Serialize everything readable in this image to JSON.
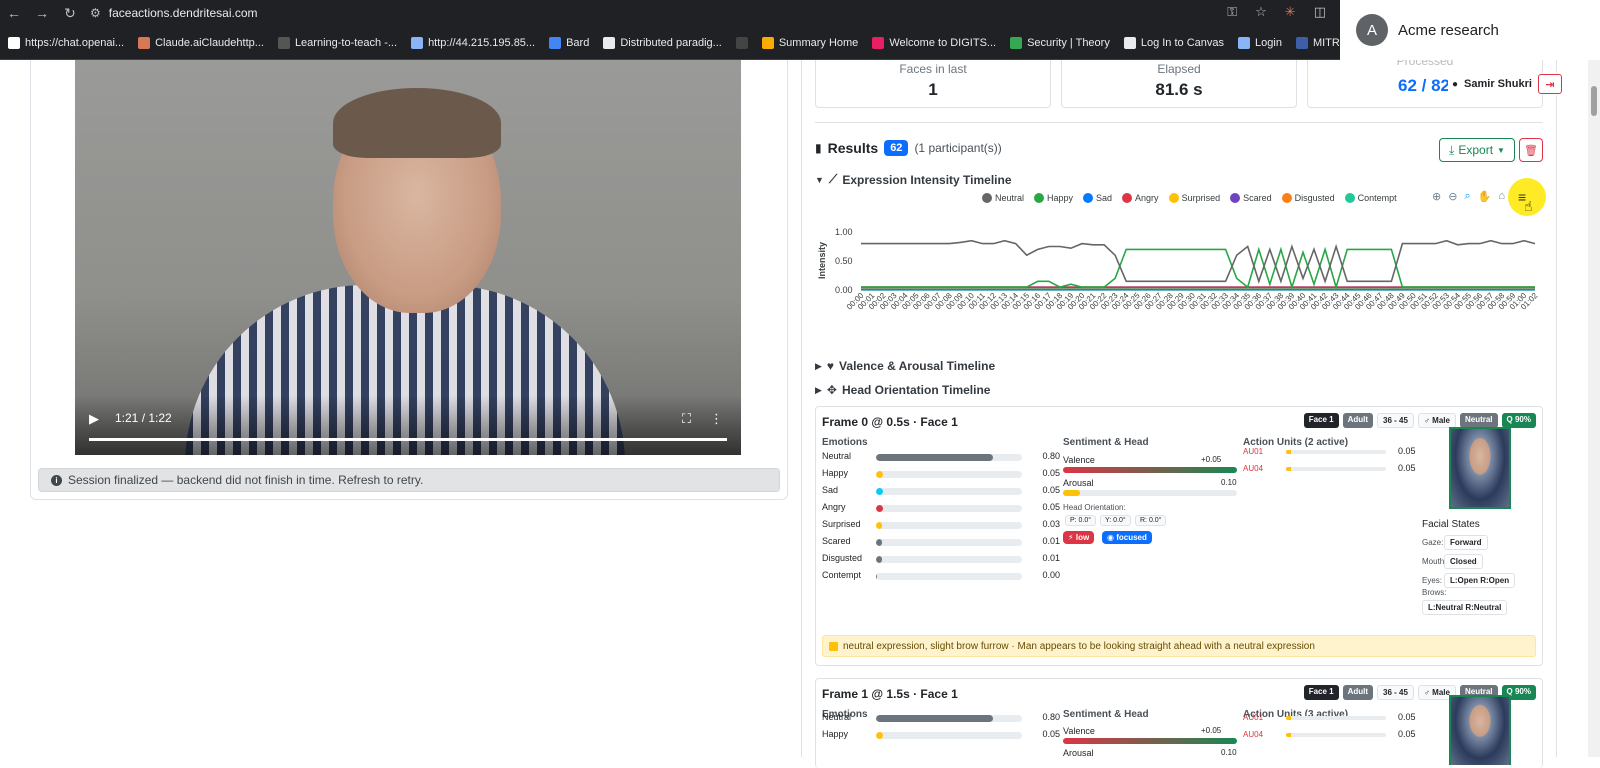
{
  "browser": {
    "url": "faceactions.dendritesai.com",
    "bookmarks": [
      {
        "label": "https://chat.openai...",
        "color": "#ffffff"
      },
      {
        "label": "Claude.aiClaudehttp...",
        "color": "#d97757"
      },
      {
        "label": "Learning-to-teach -...",
        "color": "#555555"
      },
      {
        "label": "http://44.215.195.85...",
        "color": "#8ab4f8"
      },
      {
        "label": "Bard",
        "color": "#4285f4"
      },
      {
        "label": "Distributed paradig...",
        "color": "#e8eaed"
      },
      {
        "label": "",
        "color": "#444444"
      },
      {
        "label": "Summary Home",
        "color": "#f9ab00"
      },
      {
        "label": "Welcome to DIGITS...",
        "color": "#e91e63"
      },
      {
        "label": "Security | Theory",
        "color": "#34a853"
      },
      {
        "label": "Log In to Canvas",
        "color": "#e8eaed"
      },
      {
        "label": "Login",
        "color": "#8ab4f8"
      },
      {
        "label": "MITRE ATT&CK®",
        "color": "#3c5fa8"
      }
    ],
    "profile_initial": "A",
    "profile_name": "Acme research"
  },
  "video": {
    "time": "1:21 / 1:22",
    "progress": 0.985
  },
  "alert": "Session finalized — backend did not finish in time. Refresh to retry.",
  "stats": [
    {
      "label": "Faces in last",
      "value": "1"
    },
    {
      "label": "Elapsed",
      "value": "81.6 s"
    },
    {
      "label": "Processed",
      "value": "62 / 82"
    }
  ],
  "user": {
    "name": "Samir Shukri"
  },
  "results": {
    "title": "Results",
    "count": "62",
    "participants": "(1 participant(s))",
    "export_label": "Export"
  },
  "sections": {
    "expression": "Expression Intensity Timeline",
    "valence": "Valence & Arousal Timeline",
    "head": "Head Orientation Timeline"
  },
  "chart_data": {
    "type": "line",
    "ylabel": "Intensity",
    "ylim": [
      0,
      1
    ],
    "yticks": [
      "1.00",
      "0.50",
      "0.00"
    ],
    "x": [
      "00:00",
      "00:01",
      "00:02",
      "00:03",
      "00:04",
      "00:05",
      "00:06",
      "00:07",
      "00:08",
      "00:09",
      "00:10",
      "00:11",
      "00:12",
      "00:13",
      "00:14",
      "00:15",
      "00:16",
      "00:17",
      "00:18",
      "00:19",
      "00:20",
      "00:21",
      "00:22",
      "00:23",
      "00:24",
      "00:25",
      "00:26",
      "00:27",
      "00:28",
      "00:29",
      "00:30",
      "00:31",
      "00:32",
      "00:33",
      "00:34",
      "00:35",
      "00:36",
      "00:37",
      "00:38",
      "00:39",
      "00:40",
      "00:41",
      "00:42",
      "00:43",
      "00:44",
      "00:45",
      "00:46",
      "00:47",
      "00:48",
      "00:49",
      "00:50",
      "00:51",
      "00:52",
      "00:53",
      "00:54",
      "00:55",
      "00:56",
      "00:57",
      "00:58",
      "00:59",
      "01:00",
      "01:02"
    ],
    "series": [
      {
        "name": "Neutral",
        "color": "#666666",
        "values": [
          0.8,
          0.8,
          0.8,
          0.8,
          0.8,
          0.8,
          0.8,
          0.8,
          0.8,
          0.82,
          0.85,
          0.8,
          0.8,
          0.85,
          0.8,
          0.6,
          0.7,
          0.75,
          0.75,
          0.72,
          0.8,
          0.78,
          0.78,
          0.6,
          0.15,
          0.15,
          0.15,
          0.15,
          0.15,
          0.15,
          0.15,
          0.15,
          0.15,
          0.15,
          0.6,
          0.75,
          0.15,
          0.7,
          0.15,
          0.75,
          0.2,
          0.7,
          0.15,
          0.75,
          0.15,
          0.15,
          0.15,
          0.15,
          0.15,
          0.8,
          0.8,
          0.8,
          0.8,
          0.85,
          0.78,
          0.8,
          0.8,
          0.85,
          0.8,
          0.8,
          0.85,
          0.8
        ]
      },
      {
        "name": "Happy",
        "color": "#28a745",
        "values": [
          0.05,
          0.05,
          0.05,
          0.05,
          0.05,
          0.05,
          0.05,
          0.05,
          0.05,
          0.05,
          0.05,
          0.05,
          0.05,
          0.05,
          0.05,
          0.05,
          0.15,
          0.15,
          0.05,
          0.1,
          0.05,
          0.05,
          0.05,
          0.2,
          0.7,
          0.7,
          0.7,
          0.7,
          0.7,
          0.7,
          0.7,
          0.7,
          0.7,
          0.7,
          0.2,
          0.05,
          0.7,
          0.1,
          0.7,
          0.05,
          0.65,
          0.1,
          0.7,
          0.05,
          0.7,
          0.7,
          0.7,
          0.7,
          0.7,
          0.05,
          0.05,
          0.05,
          0.05,
          0.05,
          0.05,
          0.05,
          0.05,
          0.05,
          0.05,
          0.05,
          0.05,
          0.05
        ]
      },
      {
        "name": "Sad",
        "color": "#007bff",
        "values": [
          0.04,
          0.04,
          0.04,
          0.04,
          0.04,
          0.04,
          0.04,
          0.04,
          0.04,
          0.04,
          0.04,
          0.04,
          0.04,
          0.04,
          0.04,
          0.04,
          0.04,
          0.04,
          0.04,
          0.04,
          0.04,
          0.04,
          0.04,
          0.04,
          0.04,
          0.04,
          0.04,
          0.04,
          0.04,
          0.04,
          0.04,
          0.04,
          0.04,
          0.04,
          0.04,
          0.04,
          0.04,
          0.04,
          0.04,
          0.04,
          0.04,
          0.04,
          0.04,
          0.04,
          0.04,
          0.04,
          0.04,
          0.04,
          0.04,
          0.04,
          0.04,
          0.04,
          0.04,
          0.04,
          0.04,
          0.04,
          0.04,
          0.04,
          0.04,
          0.04,
          0.04,
          0.04
        ]
      },
      {
        "name": "Angry",
        "color": "#dc3545",
        "values": [
          0.05,
          0.05,
          0.05,
          0.05,
          0.05,
          0.05,
          0.05,
          0.05,
          0.05,
          0.05,
          0.05,
          0.05,
          0.05,
          0.05,
          0.05,
          0.05,
          0.05,
          0.05,
          0.05,
          0.05,
          0.05,
          0.05,
          0.05,
          0.05,
          0.05,
          0.05,
          0.05,
          0.05,
          0.05,
          0.05,
          0.05,
          0.05,
          0.05,
          0.05,
          0.05,
          0.05,
          0.05,
          0.05,
          0.05,
          0.05,
          0.05,
          0.05,
          0.05,
          0.05,
          0.05,
          0.05,
          0.05,
          0.05,
          0.05,
          0.05,
          0.05,
          0.05,
          0.05,
          0.05,
          0.05,
          0.05,
          0.05,
          0.05,
          0.05,
          0.05,
          0.05,
          0.05
        ]
      },
      {
        "name": "Surprised",
        "color": "#ffc107",
        "values": [
          0.03,
          0.03,
          0.03,
          0.03,
          0.03,
          0.03,
          0.03,
          0.03,
          0.03,
          0.03,
          0.03,
          0.03,
          0.03,
          0.03,
          0.03,
          0.03,
          0.03,
          0.03,
          0.03,
          0.03,
          0.03,
          0.03,
          0.03,
          0.03,
          0.03,
          0.03,
          0.03,
          0.03,
          0.03,
          0.03,
          0.03,
          0.03,
          0.03,
          0.03,
          0.03,
          0.03,
          0.03,
          0.03,
          0.03,
          0.03,
          0.03,
          0.03,
          0.03,
          0.03,
          0.03,
          0.03,
          0.03,
          0.03,
          0.03,
          0.03,
          0.03,
          0.03,
          0.03,
          0.03,
          0.03,
          0.03,
          0.03,
          0.03,
          0.03,
          0.03,
          0.03,
          0.03
        ]
      },
      {
        "name": "Scared",
        "color": "#6f42c1",
        "values": [
          0.01,
          0.01,
          0.01,
          0.01,
          0.01,
          0.01,
          0.01,
          0.01,
          0.01,
          0.01,
          0.01,
          0.01,
          0.01,
          0.01,
          0.01,
          0.01,
          0.01,
          0.01,
          0.01,
          0.01,
          0.01,
          0.01,
          0.01,
          0.01,
          0.01,
          0.01,
          0.01,
          0.01,
          0.01,
          0.01,
          0.01,
          0.01,
          0.01,
          0.01,
          0.01,
          0.01,
          0.01,
          0.01,
          0.01,
          0.01,
          0.01,
          0.01,
          0.01,
          0.01,
          0.01,
          0.01,
          0.01,
          0.01,
          0.01,
          0.01,
          0.01,
          0.01,
          0.01,
          0.01,
          0.01,
          0.01,
          0.01,
          0.01,
          0.01,
          0.01,
          0.01,
          0.01
        ]
      },
      {
        "name": "Disgusted",
        "color": "#fd7e14",
        "values": [
          0.02,
          0.02,
          0.02,
          0.02,
          0.02,
          0.02,
          0.02,
          0.02,
          0.02,
          0.02,
          0.02,
          0.02,
          0.02,
          0.02,
          0.02,
          0.02,
          0.02,
          0.02,
          0.02,
          0.02,
          0.02,
          0.02,
          0.02,
          0.02,
          0.02,
          0.02,
          0.02,
          0.02,
          0.02,
          0.02,
          0.02,
          0.02,
          0.02,
          0.02,
          0.02,
          0.02,
          0.02,
          0.02,
          0.02,
          0.02,
          0.02,
          0.02,
          0.02,
          0.02,
          0.02,
          0.02,
          0.02,
          0.02,
          0.02,
          0.02,
          0.02,
          0.02,
          0.02,
          0.02,
          0.02,
          0.02,
          0.02,
          0.02,
          0.02,
          0.02,
          0.02,
          0.02
        ]
      },
      {
        "name": "Contempt",
        "color": "#20c997",
        "values": [
          0.0,
          0.0,
          0.0,
          0.0,
          0.0,
          0.0,
          0.0,
          0.0,
          0.0,
          0.0,
          0.0,
          0.0,
          0.0,
          0.0,
          0.0,
          0.0,
          0.0,
          0.0,
          0.0,
          0.0,
          0.0,
          0.0,
          0.0,
          0.0,
          0.0,
          0.0,
          0.0,
          0.0,
          0.0,
          0.0,
          0.0,
          0.0,
          0.0,
          0.0,
          0.0,
          0.0,
          0.0,
          0.0,
          0.0,
          0.0,
          0.0,
          0.0,
          0.0,
          0.0,
          0.0,
          0.0,
          0.0,
          0.0,
          0.0,
          0.0,
          0.0,
          0.0,
          0.0,
          0.0,
          0.0,
          0.0,
          0.0,
          0.0,
          0.0,
          0.0,
          0.0,
          0.0
        ]
      }
    ]
  },
  "frames": [
    {
      "title": "Frame 0 @ 0.5s · Face 1",
      "badges": [
        "Face 1",
        "Adult",
        "36 - 45",
        "♂ Male",
        "Neutral",
        "Q 90%"
      ],
      "emotions_label": "Emotions",
      "emotions": [
        {
          "name": "Neutral",
          "value": "0.80",
          "frac": 0.8,
          "color": "#6c757d"
        },
        {
          "name": "Happy",
          "value": "0.05",
          "frac": 0.05,
          "color": "#ffc107"
        },
        {
          "name": "Sad",
          "value": "0.05",
          "frac": 0.05,
          "color": "#0dcaf0"
        },
        {
          "name": "Angry",
          "value": "0.05",
          "frac": 0.05,
          "color": "#dc3545"
        },
        {
          "name": "Surprised",
          "value": "0.03",
          "frac": 0.03,
          "color": "#ffc107"
        },
        {
          "name": "Scared",
          "value": "0.01",
          "frac": 0.01,
          "color": "#6c757d"
        },
        {
          "name": "Disgusted",
          "value": "0.01",
          "frac": 0.01,
          "color": "#6c757d"
        },
        {
          "name": "Contempt",
          "value": "0.00",
          "frac": 0.0,
          "color": "#6c757d"
        }
      ],
      "sentiment_label": "Sentiment & Head",
      "valence_label": "Valence",
      "valence_value": "+0.05",
      "arousal_label": "Arousal",
      "arousal_value": "0.10",
      "head_label": "Head Orientation:",
      "head_chips": [
        "P: 0.0°",
        "Y: 0.0°",
        "R: 0.0°"
      ],
      "pill_low": "low",
      "pill_focused": "focused",
      "au_label": "Action Units (2 active)",
      "aus": [
        {
          "name": "AU01",
          "value": "0.05"
        },
        {
          "name": "AU04",
          "value": "0.05"
        }
      ],
      "facial_states_label": "Facial States",
      "states": [
        {
          "label": "Gaze:",
          "value": "Forward"
        },
        {
          "label": "Mouth:",
          "value": "Closed"
        },
        {
          "label": "Eyes:",
          "value": "L:Open R:Open"
        },
        {
          "label": "Brows:",
          "value": "L:Neutral R:Neutral"
        }
      ],
      "note": "neutral expression, slight brow furrow · Man appears to be looking straight ahead with a neutral expression"
    },
    {
      "title": "Frame 1 @ 1.5s · Face 1",
      "badges": [
        "Face 1",
        "Adult",
        "36 - 45",
        "♂ Male",
        "Neutral",
        "Q 90%"
      ],
      "emotions_label": "Emotions",
      "emotions": [
        {
          "name": "Neutral",
          "value": "0.80",
          "frac": 0.8,
          "color": "#6c757d"
        },
        {
          "name": "Happy",
          "value": "0.05",
          "frac": 0.05,
          "color": "#ffc107"
        }
      ],
      "sentiment_label": "Sentiment & Head",
      "valence_label": "Valence",
      "valence_value": "+0.05",
      "arousal_label": "Arousal",
      "arousal_value": "0.10",
      "au_label": "Action Units (3 active)",
      "aus": [
        {
          "name": "AU01",
          "value": "0.05"
        },
        {
          "name": "AU04",
          "value": "0.05"
        }
      ]
    }
  ]
}
